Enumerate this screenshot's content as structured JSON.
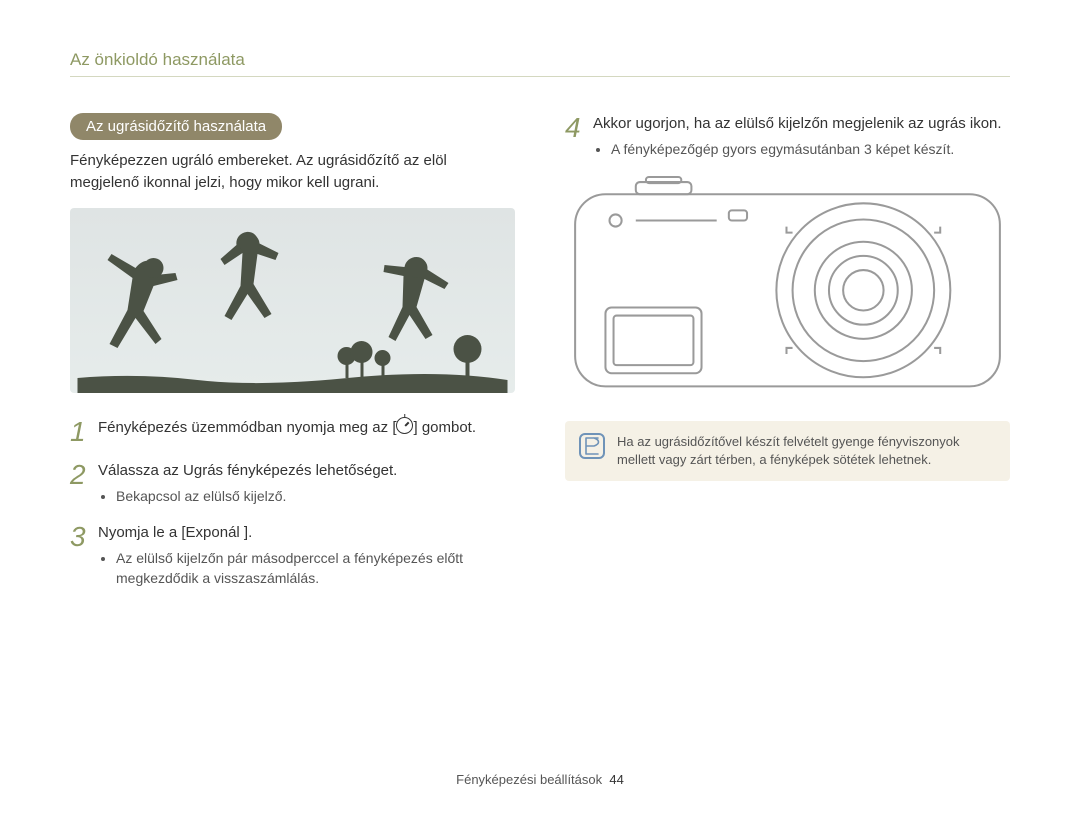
{
  "header": "Az önkioldó használata",
  "pill": "Az ugrásidőzítő használata",
  "intro": "Fényképezzen ugráló embereket. Az ugrásidőzítő az elöl megjelenő ikonnal jelzi, hogy mikor kell ugrani.",
  "steps": [
    {
      "num": "1",
      "text_pre": "Fényképezés üzemmódban nyomja meg az [",
      "text_post": "] gombot.",
      "has_icon": true,
      "subs": []
    },
    {
      "num": "2",
      "text": "Válassza az Ugrás fényképezés lehetőséget.",
      "subs": [
        "Bekapcsol az elülső kijelző."
      ]
    },
    {
      "num": "3",
      "text": "Nyomja le a [Exponál ].",
      "subs": [
        "Az elülső kijelzőn pár másodperccel a fényképezés előtt megkezdődik a visszaszámlálás."
      ]
    },
    {
      "num": "4",
      "text": "Akkor ugorjon, ha az elülső kijelzőn megjelenik az ugrás ikon.",
      "subs": [
        "A fényképezőgép gyors egymásutánban 3 képet készít."
      ]
    }
  ],
  "note": "Ha az ugrásidőzítővel készít felvételt gyenge fényviszonyok mellett vagy zárt térben, a fényképek sötétek lehetnek.",
  "footer_label": "Fényképezési beállítások",
  "footer_page": "44",
  "icons": {
    "timer": "timer-icon",
    "note": "note-icon"
  }
}
